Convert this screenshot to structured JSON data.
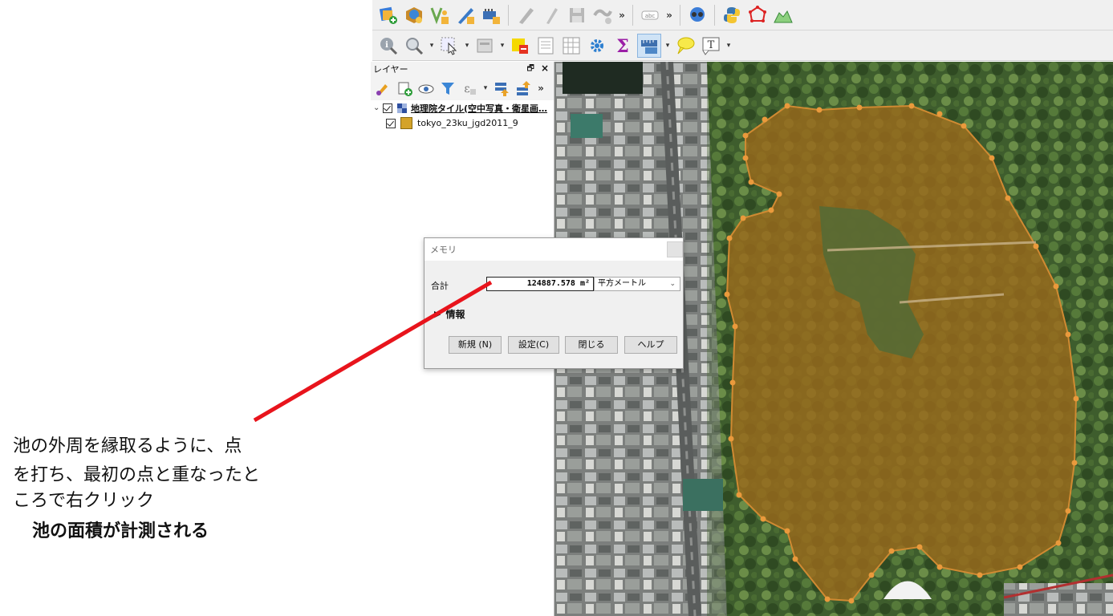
{
  "toolbar1": {
    "icons": [
      "add-layer-icon",
      "open-data-source-icon",
      "new-vector-icon",
      "digitize-icon",
      "add-wms-icon",
      "edit-pencil-icon",
      "edit-pencil2-icon",
      "save-edits-icon",
      "node-tool-icon",
      "label-icon",
      "identify-globe-icon",
      "python-icon",
      "polygon-icon",
      "profile-icon"
    ],
    "more_symbol": "»"
  },
  "toolbar2": {
    "icons": [
      "identify-icon",
      "zoom-select-icon",
      "select-features-icon",
      "deselect-icon",
      "attribute-table-icon",
      "field-calc-icon",
      "settings-gear-icon",
      "statistics-sigma-icon",
      "measure-icon",
      "map-tips-icon",
      "text-annotation-icon"
    ]
  },
  "layers_panel": {
    "title": "レイヤー",
    "float_symbol": "🗗",
    "close_symbol": "×",
    "more_symbol": "»",
    "layers": [
      {
        "name": "地理院タイル(空中写真・衛星画…",
        "checked": true,
        "type": "raster",
        "color": "#2d4fa0"
      },
      {
        "name": "tokyo_23ku_jgd2011_9",
        "checked": true,
        "type": "polygon",
        "color": "#d4a32a"
      }
    ]
  },
  "measure_dialog": {
    "title": "メモリ",
    "total_label": "合計",
    "total_value": "124887.578 m²",
    "unit": "平方メートル",
    "info_label": "情報",
    "buttons": {
      "new": "新規 (N)",
      "settings": "設定(C)",
      "close": "閉じる",
      "help": "ヘルプ"
    }
  },
  "annotation": {
    "line1": "池の外周を縁取るように、点",
    "line2": "を打ち、最初の点と重なったと",
    "line3": "ころで右クリック",
    "line4": "池の面積が計測される",
    "arrow_color": "#e8141c"
  },
  "map": {
    "polygon_color": "#b07a20",
    "vertex_color": "#e9963a"
  }
}
